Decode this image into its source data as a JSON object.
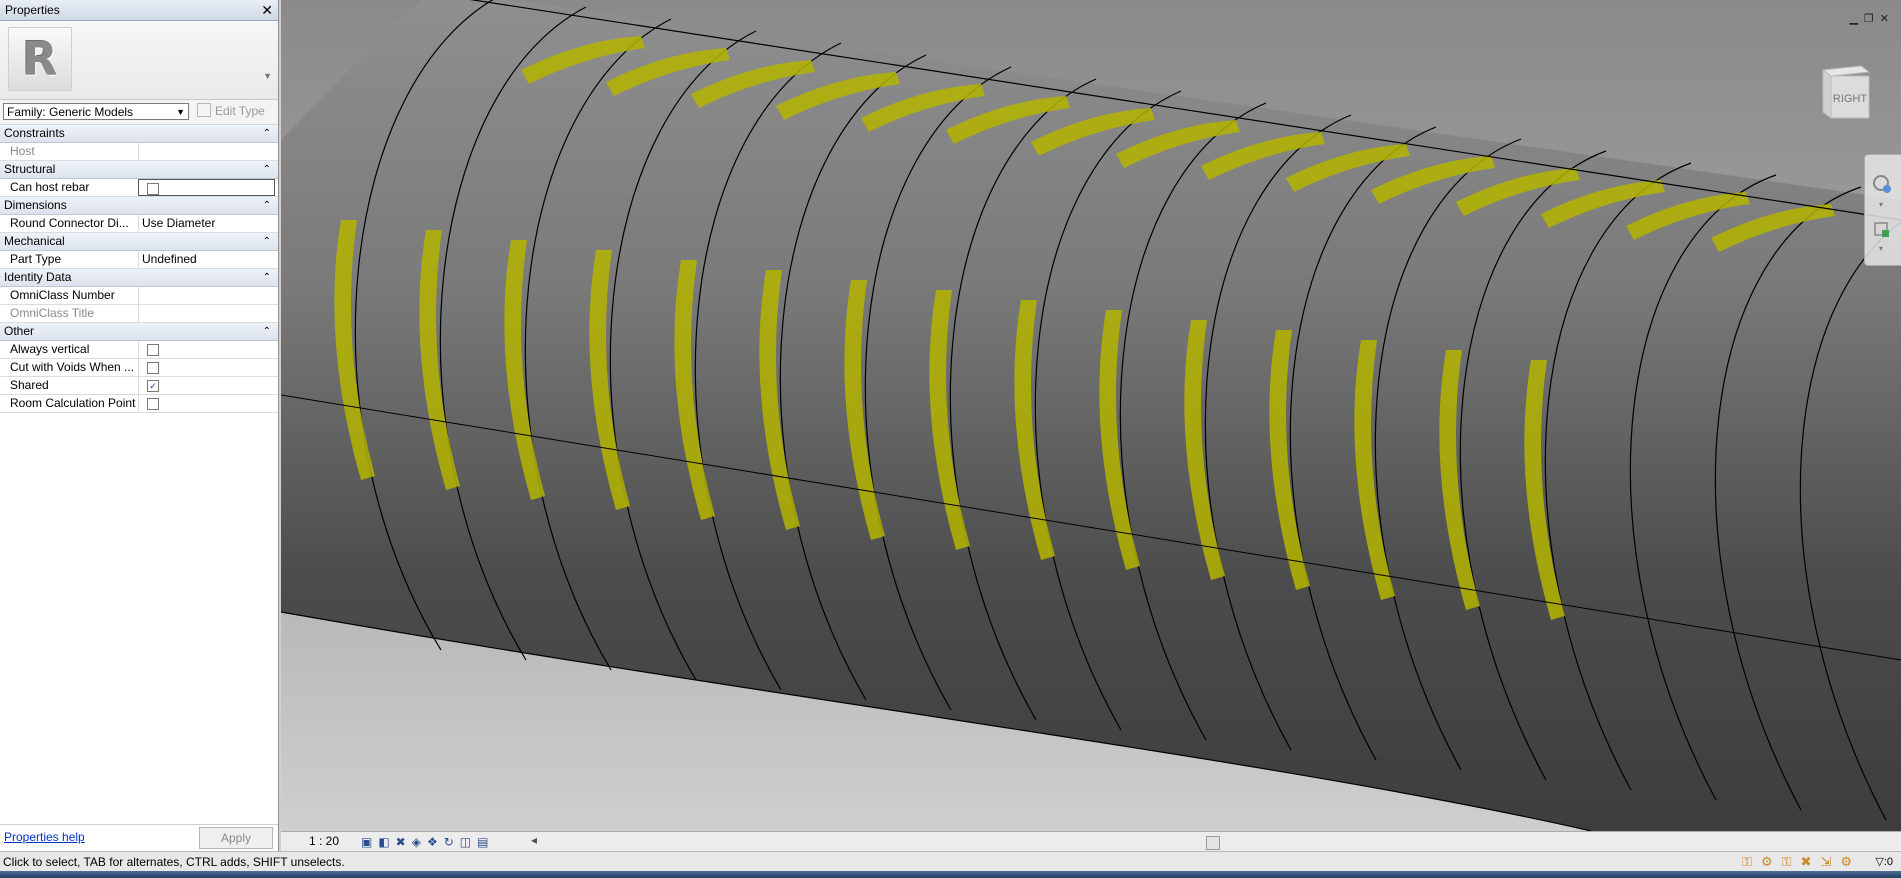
{
  "properties": {
    "title": "Properties",
    "family_selector": "Family: Generic Models",
    "edit_type_label": "Edit Type",
    "groups": [
      {
        "name": "Constraints",
        "rows": [
          {
            "label": "Host",
            "value": "",
            "greyed": true
          }
        ]
      },
      {
        "name": "Structural",
        "rows": [
          {
            "label": "Can host rebar",
            "checkbox": true,
            "checked": false,
            "active": true
          }
        ]
      },
      {
        "name": "Dimensions",
        "rows": [
          {
            "label": "Round Connector Di...",
            "value": "Use Diameter"
          }
        ]
      },
      {
        "name": "Mechanical",
        "rows": [
          {
            "label": "Part Type",
            "value": "Undefined"
          }
        ]
      },
      {
        "name": "Identity Data",
        "rows": [
          {
            "label": "OmniClass Number",
            "value": ""
          },
          {
            "label": "OmniClass Title",
            "value": "",
            "greyed": true
          }
        ]
      },
      {
        "name": "Other",
        "rows": [
          {
            "label": "Always vertical",
            "checkbox": true,
            "checked": false
          },
          {
            "label": "Cut with Voids When ...",
            "checkbox": true,
            "checked": false
          },
          {
            "label": "Shared",
            "checkbox": true,
            "checked": true
          },
          {
            "label": "Room Calculation Point",
            "checkbox": true,
            "checked": false
          }
        ]
      }
    ],
    "help_link": "Properties help",
    "apply_label": "Apply"
  },
  "viewport": {
    "viewcube_face": "RIGHT",
    "scale": "1 : 20"
  },
  "status_bar": {
    "message": "Click to select, TAB for alternates, CTRL adds, SHIFT unselects.",
    "filter_count": ":0"
  },
  "colors": {
    "highlight": "#b4b400",
    "model_shade": "#4a4a4a",
    "background_top": "#8a8a8a",
    "background_bottom": "#cfcfcf"
  }
}
